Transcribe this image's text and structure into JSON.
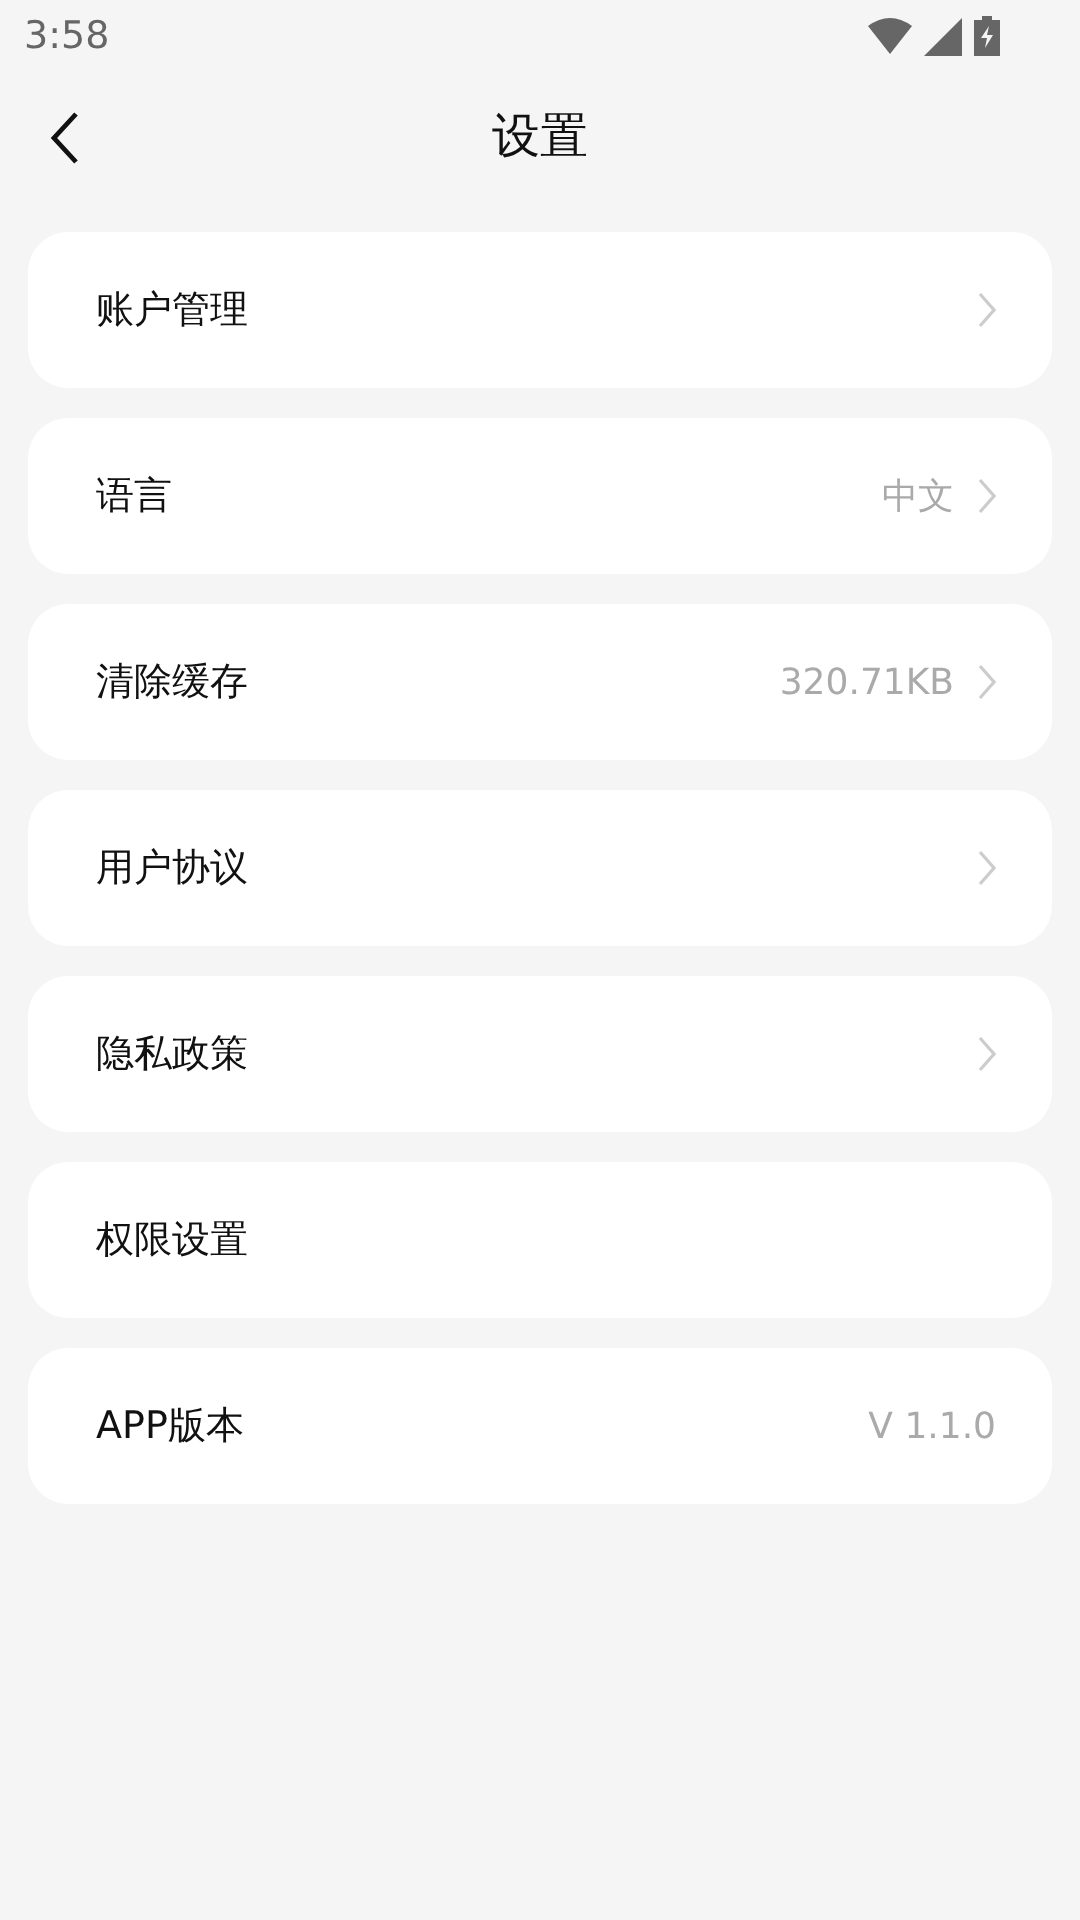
{
  "status_bar": {
    "time": "3:58"
  },
  "header": {
    "title": "设置"
  },
  "items": [
    {
      "label": "账户管理",
      "chevron": true
    },
    {
      "label": "语言",
      "value": "中文",
      "chevron": true
    },
    {
      "label": "清除缓存",
      "value": "320.71KB",
      "chevron": true
    },
    {
      "label": "用户协议",
      "chevron": true
    },
    {
      "label": "隐私政策",
      "chevron": true
    },
    {
      "label": "权限设置",
      "chevron": false
    },
    {
      "label": "APP版本",
      "value": "V 1.1.0",
      "chevron": false
    }
  ]
}
